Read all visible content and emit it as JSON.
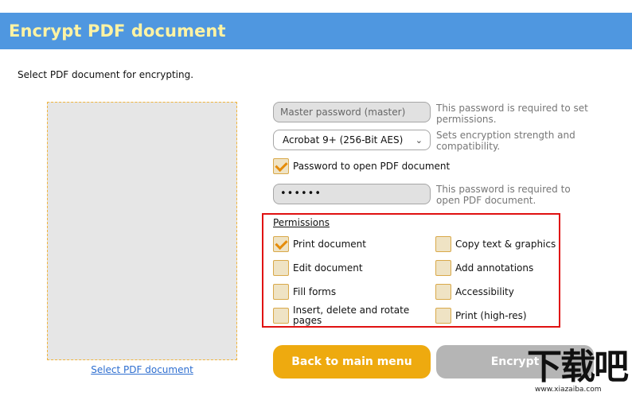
{
  "header": {
    "title": "Encrypt PDF document"
  },
  "instruction": "Select PDF document for encrypting.",
  "preview": {
    "link": "Select PDF document"
  },
  "master_password": {
    "placeholder": "Master password (master)",
    "help": "This password is required to set permissions."
  },
  "encryption": {
    "selected": "Acrobat 9+ (256-Bit AES)",
    "help": "Sets encryption strength and compatibility."
  },
  "open_password": {
    "checked": true,
    "label": "Password to open PDF document",
    "value": "••••••",
    "help": "This password is required to open PDF document."
  },
  "permissions": {
    "title": "Permissions",
    "items": [
      {
        "label": "Print document",
        "checked": true
      },
      {
        "label": "Copy text & graphics",
        "checked": false
      },
      {
        "label": "Edit document",
        "checked": false
      },
      {
        "label": "Add annotations",
        "checked": false
      },
      {
        "label": "Fill forms",
        "checked": false
      },
      {
        "label": "Accessibility",
        "checked": false
      },
      {
        "label": "Insert, delete and rotate pages",
        "checked": false
      },
      {
        "label": "Print (high-res)",
        "checked": false
      }
    ]
  },
  "buttons": {
    "back": "Back to main menu",
    "encrypt": "Encrypt"
  },
  "watermark": {
    "text": "下载吧",
    "url": "www.xiazaiba.com"
  }
}
